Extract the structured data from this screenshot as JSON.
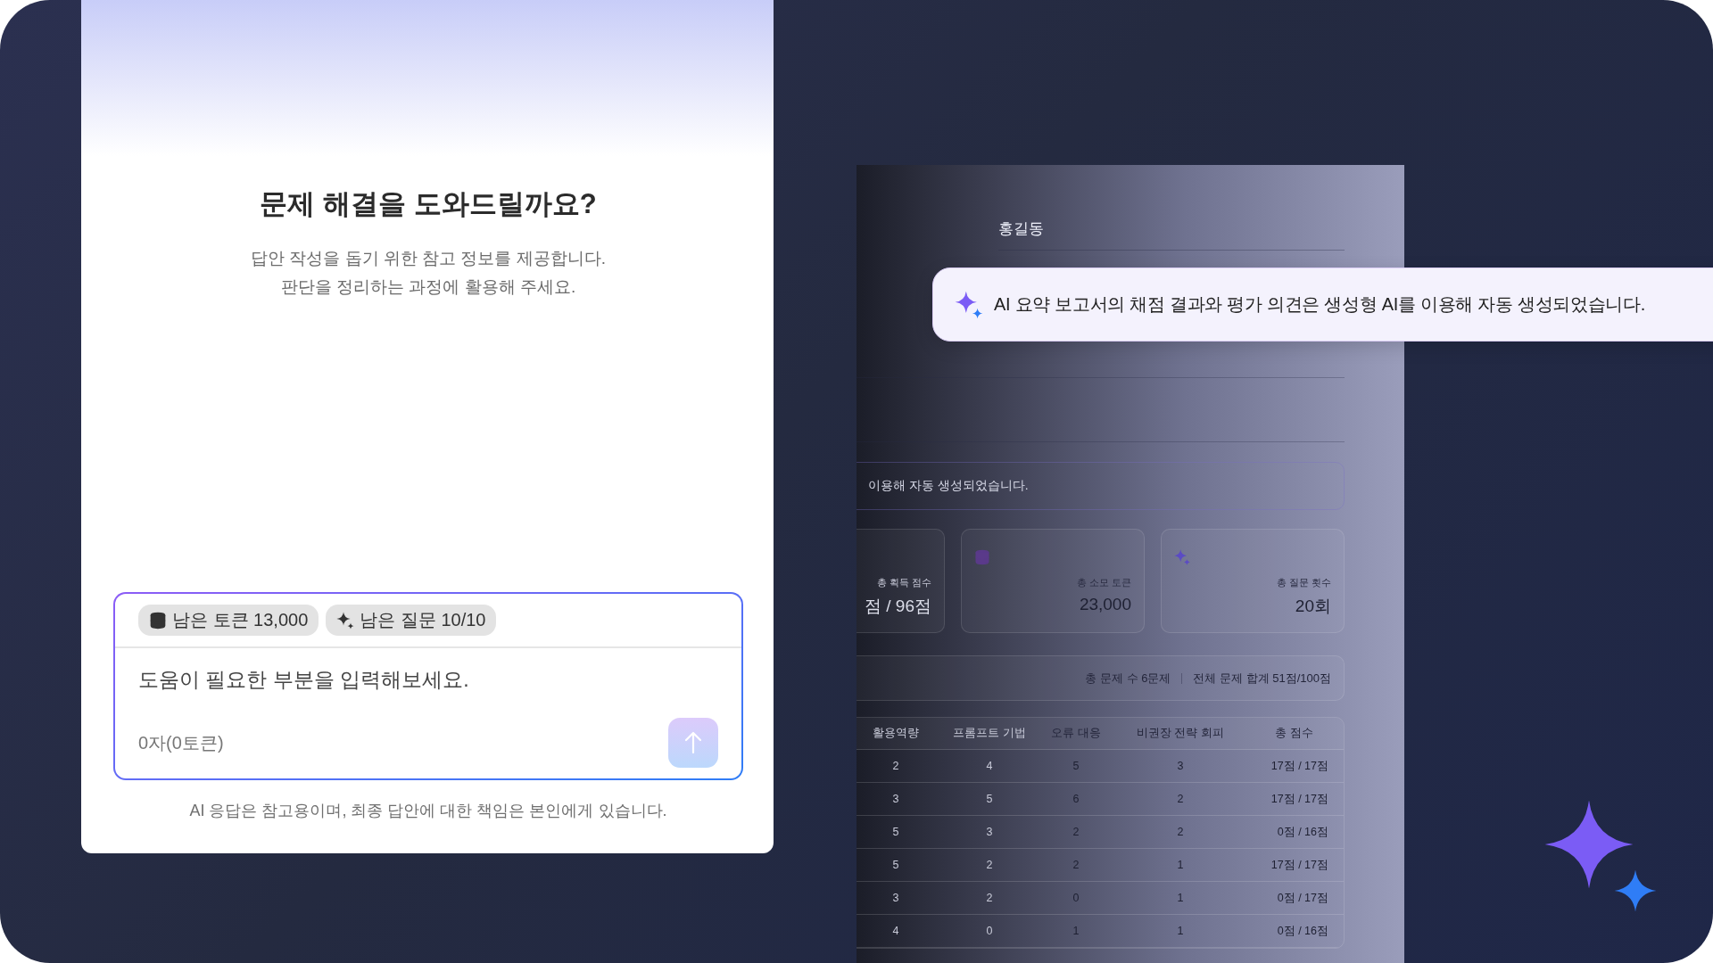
{
  "assistant_panel": {
    "title": "문제 해결을 도와드릴까요?",
    "subtitle_lines": [
      "답안 작성을 돕기 위한 참고 정보를 제공합니다.",
      "판단을 정리하는 과정에 활용해 주세요."
    ],
    "chips": [
      {
        "kind": "tokens",
        "label": "남은 토큰 13,000"
      },
      {
        "kind": "questions",
        "label": "남은 질문 10/10"
      }
    ],
    "input": {
      "placeholder": "도움이 필요한 부분을 입력해보세요."
    },
    "counter": "0자(0토큰)",
    "send_button": {
      "disabled": true
    },
    "disclaimer": "AI 응답은 참고용이며, 최종 답안에 대한 책임은 본인에게 있습니다."
  },
  "report": {
    "name": "홍길동",
    "notice": "이용해 자동 생성되었습니다.",
    "stats": [
      {
        "kind": "score",
        "label": "총 획득 점수",
        "value": "점 / 96점"
      },
      {
        "kind": "tokens",
        "label": "총 소모 토큰",
        "value": "23,000"
      },
      {
        "kind": "questions",
        "label": "총 질문 횟수",
        "value": "20회"
      }
    ],
    "summary": [
      "총 문제 수 6문제",
      "전체 문제 합계 51점/100점"
    ],
    "table": {
      "columns": [
        "활용역량",
        "프롬프트 기법",
        "오류 대응",
        "비권장 전략 회피",
        "총 점수"
      ],
      "rows": [
        [
          "2",
          "4",
          "5",
          "3",
          "17점 / 17점"
        ],
        [
          "3",
          "5",
          "6",
          "2",
          "17점 / 17점"
        ],
        [
          "5",
          "3",
          "2",
          "2",
          "0점 / 16점"
        ],
        [
          "5",
          "2",
          "2",
          "1",
          "17점 / 17점"
        ],
        [
          "3",
          "2",
          "0",
          "1",
          "0점 / 17점"
        ],
        [
          "4",
          "0",
          "1",
          "1",
          "0점 / 16점"
        ]
      ]
    }
  },
  "ai_notice": {
    "text": "AI 요약 보고서의 채점 결과와 평가 의견은 생성형 AI를 이용해 자동 생성되었습니다."
  }
}
